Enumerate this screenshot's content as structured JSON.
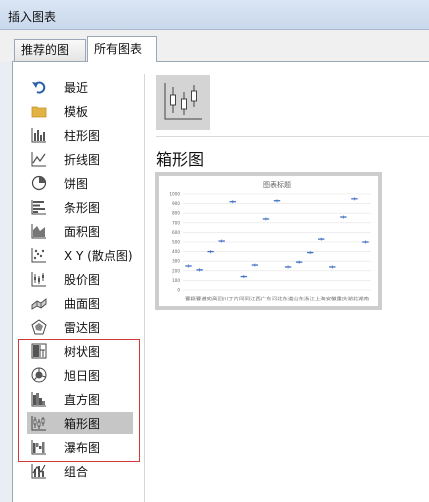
{
  "window": {
    "title": "插入图表"
  },
  "tabs": [
    {
      "label": "推荐的图表",
      "active": false
    },
    {
      "label": "所有图表",
      "active": true
    }
  ],
  "sidebar": {
    "items": [
      {
        "label": "最近",
        "icon": "undo-arrow-icon"
      },
      {
        "label": "模板",
        "icon": "folder-icon"
      },
      {
        "label": "柱形图",
        "icon": "column-chart-icon"
      },
      {
        "label": "折线图",
        "icon": "line-chart-icon"
      },
      {
        "label": "饼图",
        "icon": "pie-chart-icon"
      },
      {
        "label": "条形图",
        "icon": "bar-chart-icon"
      },
      {
        "label": "面积图",
        "icon": "area-chart-icon"
      },
      {
        "label": "X Y (散点图)",
        "icon": "scatter-chart-icon"
      },
      {
        "label": "股价图",
        "icon": "stock-chart-icon"
      },
      {
        "label": "曲面图",
        "icon": "surface-chart-icon"
      },
      {
        "label": "雷达图",
        "icon": "radar-chart-icon"
      },
      {
        "label": "树状图",
        "icon": "treemap-chart-icon"
      },
      {
        "label": "旭日图",
        "icon": "sunburst-chart-icon"
      },
      {
        "label": "直方图",
        "icon": "histogram-chart-icon"
      },
      {
        "label": "箱形图",
        "icon": "box-whisker-chart-icon",
        "selected": true
      },
      {
        "label": "瀑布图",
        "icon": "waterfall-chart-icon"
      },
      {
        "label": "组合",
        "icon": "combo-chart-icon"
      }
    ]
  },
  "main": {
    "chart_type_title": "箱形图",
    "highlight_color": "#d23a3a",
    "accent_color": "#4472c4"
  },
  "chart_data": {
    "type": "scatter",
    "title": "图表标题",
    "xlabel": "",
    "ylabel": "",
    "ylim": [
      0,
      1000
    ],
    "yticks": [
      0,
      100,
      200,
      300,
      400,
      500,
      600,
      700,
      800,
      900,
      1000
    ],
    "grid": true,
    "series": [
      {
        "values": [
          250,
          210,
          400,
          510,
          920,
          140,
          260,
          740,
          930,
          240,
          290,
          390,
          530,
          240,
          760,
          950,
          500
        ]
      }
    ],
    "x_labels_text": "曹颖曹谱宛高回川丁片同同江西广东河北东道山东浙江上海安徽重庆湖北湖南"
  }
}
